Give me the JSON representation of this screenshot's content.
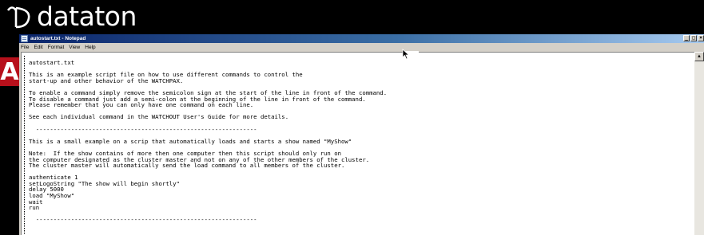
{
  "logo": {
    "text": "dataton",
    "icon": "dataton-logo-icon"
  },
  "accent": {
    "text": "A",
    "color": "#b7101b"
  },
  "window": {
    "title": "autostart.txt - Notepad",
    "buttons": {
      "minimize": "_",
      "maximize": "□",
      "close": "×"
    }
  },
  "menu": [
    "File",
    "Edit",
    "Format",
    "View",
    "Help"
  ],
  "document": {
    "lines": [
      "autostart.txt",
      "",
      "This is an example script file on how to use different commands to control the",
      "start-up and other behavior of the WATCHPAX.",
      "",
      "To enable a command simply remove the semicolon sign at the start of the line in front of the command.",
      "To disable a command just add a semi-colon at the beginning of the line in front of the command.",
      "Please remember that you can only have one command on each line.",
      "",
      "See each individual command in the WATCHOUT User's Guide for more details.",
      "",
      "  ---------------------------------------------------------------",
      "",
      "This is a small example on a scrip that automatically loads and starts a show named \"MyShow\"",
      "",
      "Note:  If the show contains of more then one computer then this script should only run on",
      "the computer designated as the cluster master and not on any of the other members of the cluster.",
      "The cluster master will automatically send the load command to all members of the cluster.",
      "",
      "authenticate 1",
      "setLogoString \"The show will begin shortly\"",
      "delay 5000",
      "load \"MyShow\"",
      "wait",
      "run",
      "",
      "  ---------------------------------------------------------------"
    ]
  },
  "colors": {
    "titlebar_start": "#0a246a",
    "titlebar_end": "#a6caf0",
    "chrome": "#d4d0c8"
  }
}
